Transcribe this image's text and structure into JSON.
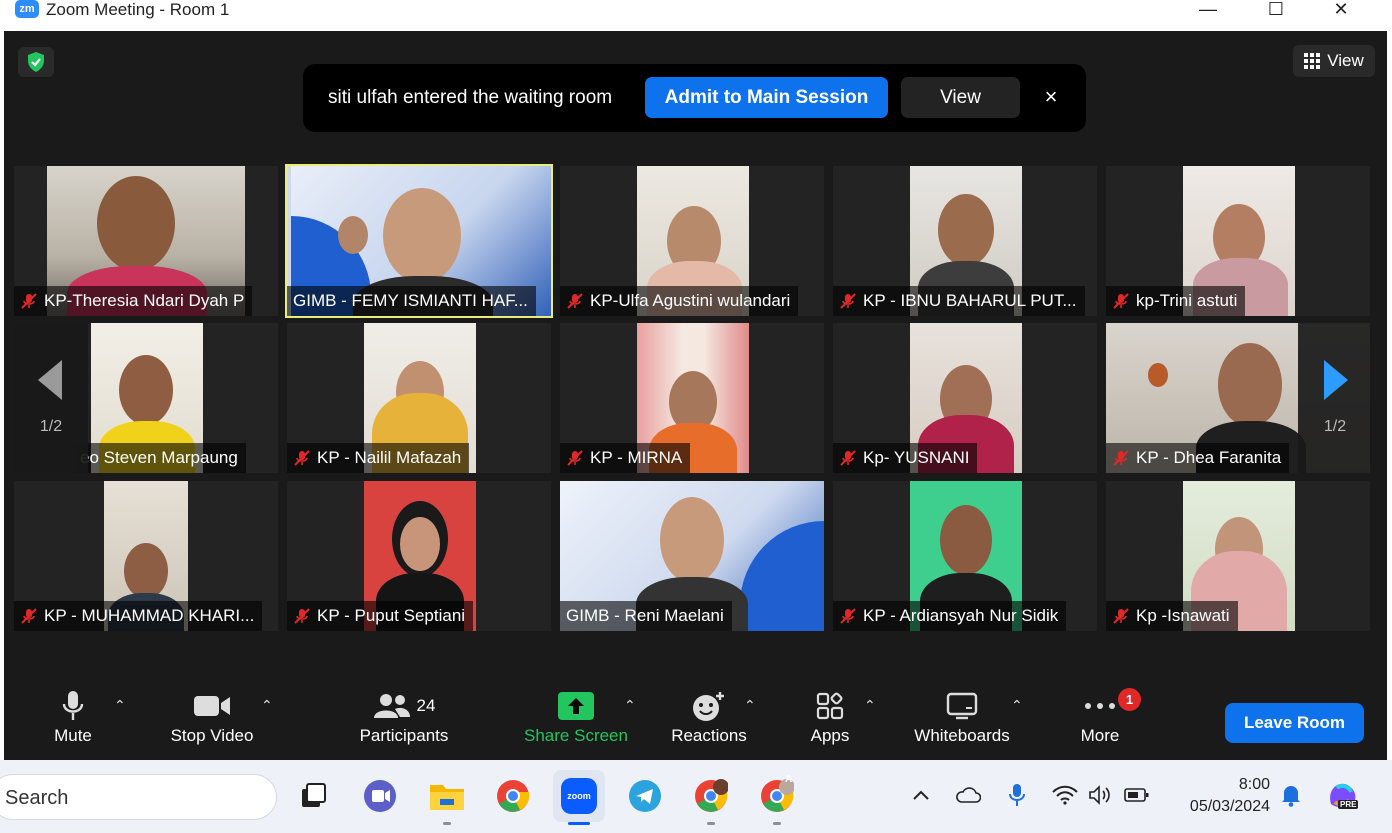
{
  "window": {
    "logo_text": "zm",
    "title": "Zoom Meeting - Room 1",
    "minimize": "—",
    "maximize": "☐",
    "close": "✕"
  },
  "top": {
    "view_label": "View"
  },
  "notification": {
    "message": "siti ulfah entered the waiting room",
    "admit_label": "Admit to Main Session",
    "view_label": "View",
    "close": "×"
  },
  "participants": [
    {
      "name": "KP-Theresia Ndari Dyah P"
    },
    {
      "name": "GIMB - FEMY ISMIANTI HAF..."
    },
    {
      "name": "KP-Ulfa Agustini wulandari"
    },
    {
      "name": "KP - IBNU BAHARUL PUT..."
    },
    {
      "name": "kp-Trini astuti"
    },
    {
      "name": "eo Steven Marpaung"
    },
    {
      "name": "KP - Nailil Mafazah"
    },
    {
      "name": "KP - MIRNA"
    },
    {
      "name": "Kp- YUSNANI"
    },
    {
      "name": "KP - Dhea Faranita"
    },
    {
      "name": "KP - MUHAMMAD KHARI..."
    },
    {
      "name": "KP - Puput Septiani"
    },
    {
      "name": "GIMB - Reni Maelani"
    },
    {
      "name": "KP - Ardiansyah Nur Sidik"
    },
    {
      "name": "Kp -Isnawati"
    }
  ],
  "pager": {
    "left": "1/2",
    "right": "1/2"
  },
  "toolbar": {
    "mute": "Mute",
    "stop_video": "Stop Video",
    "participants": "Participants",
    "participants_count": "24",
    "share_screen": "Share Screen",
    "reactions": "Reactions",
    "apps": "Apps",
    "whiteboards": "Whiteboards",
    "more": "More",
    "more_badge": "1",
    "leave": "Leave Room"
  },
  "taskbar": {
    "search": "Search",
    "time": "8:00",
    "date": "05/03/2024",
    "zoom_icon_text": "zoom",
    "chrome_profile_letter": "A",
    "copilot_badge": "PRE"
  },
  "colors": {
    "zoom_blue": "#0E72ED",
    "share_green": "#22c55e",
    "active_speaker": "#e8ec7a",
    "badge_red": "#e02828"
  }
}
